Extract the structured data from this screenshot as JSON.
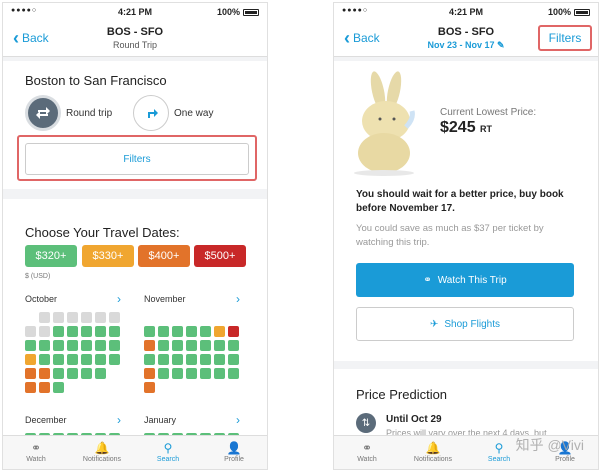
{
  "left": {
    "status": {
      "signal": "●●●●○",
      "time": "4:21 PM",
      "battery": "100%"
    },
    "nav": {
      "back": "Back",
      "title": "BOS - SFO",
      "subtitle": "Round Trip"
    },
    "route_title": "Boston to San Francisco",
    "trip_types": [
      {
        "label": "Round trip",
        "selected": true
      },
      {
        "label": "One way",
        "selected": false
      }
    ],
    "filters_label": "Filters",
    "dates_title": "Choose Your Travel Dates:",
    "price_buttons": [
      {
        "label": "$320+",
        "color": "#5cbf7a"
      },
      {
        "label": "$330+",
        "color": "#f0a630"
      },
      {
        "label": "$400+",
        "color": "#e2732a"
      },
      {
        "label": "$500+",
        "color": "#c82828"
      }
    ],
    "currency_note": "$ (USD)",
    "months_row1": [
      "October",
      "November"
    ],
    "months_row2": [
      "December",
      "January"
    ],
    "tabs": [
      {
        "label": "Watch",
        "icon": "binoculars-icon",
        "glyph": "⚭",
        "active": false
      },
      {
        "label": "Notifications",
        "icon": "bell-icon",
        "glyph": "🔔",
        "active": false
      },
      {
        "label": "Search",
        "icon": "search-icon",
        "glyph": "⚲",
        "active": true
      },
      {
        "label": "Profile",
        "icon": "profile-icon",
        "glyph": "👤",
        "active": false
      }
    ]
  },
  "right": {
    "status": {
      "signal": "●●●●○",
      "time": "4:21 PM",
      "battery": "100%"
    },
    "nav": {
      "back": "Back",
      "title": "BOS - SFO",
      "subtitle": "Nov 23 - Nov 17",
      "filters": "Filters"
    },
    "price_label": "Current Lowest Price:",
    "price_value": "$245",
    "price_suffix": "RT",
    "advice_bold": "You should wait for a better price, buy book before November 17.",
    "advice_sub": "You could save as much as $37 per ticket by watching this trip.",
    "watch_button": "Watch This Trip",
    "shop_button": "Shop Flights",
    "prediction_title": "Price Prediction",
    "prediction_item_title": "Until Oct 29",
    "prediction_item_text": "Prices will vary over the next 4 days, but",
    "watermark": "知乎 @Vivi",
    "tabs": [
      {
        "label": "Watch",
        "icon": "binoculars-icon",
        "glyph": "⚭",
        "active": false
      },
      {
        "label": "Notifications",
        "icon": "bell-icon",
        "glyph": "🔔",
        "active": false
      },
      {
        "label": "Search",
        "icon": "search-icon",
        "glyph": "⚲",
        "active": true
      },
      {
        "label": "Profile",
        "icon": "profile-icon",
        "glyph": "👤",
        "active": false
      }
    ]
  },
  "colors": {
    "accent": "#1a9bd7",
    "highlight": "#e06666",
    "grey_cell": "#d9d9d9",
    "green": "#5cbf7a",
    "orange": "#f0a630",
    "dark_orange": "#e2732a",
    "red": "#c82828"
  }
}
